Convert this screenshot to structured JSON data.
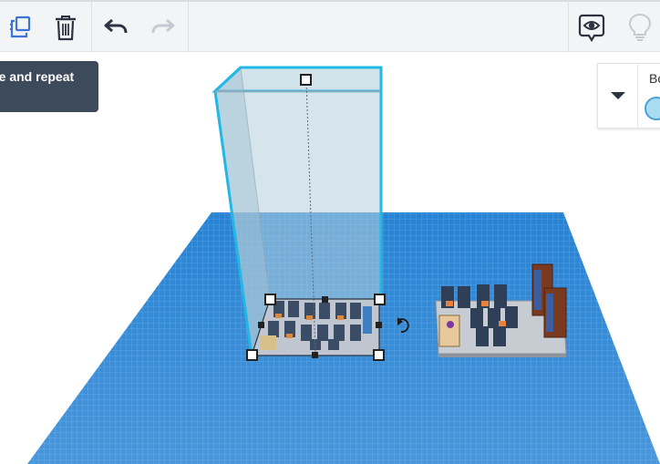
{
  "toolbar": {
    "items": [
      {
        "name": "duplicate-and-repeat",
        "icon": "duplicate-icon"
      },
      {
        "name": "delete",
        "icon": "trash-icon"
      },
      {
        "name": "undo",
        "icon": "undo-arrow-icon"
      },
      {
        "name": "redo",
        "icon": "redo-arrow-icon",
        "disabled": true
      },
      {
        "name": "show-all",
        "icon": "eye-speech-bubble-icon"
      },
      {
        "name": "notes",
        "icon": "lightbulb-icon",
        "disabled": true
      }
    ]
  },
  "tooltip": {
    "text": "te and repeat"
  },
  "inspector": {
    "label": "Bo",
    "color_swatch": "#a9dcf0",
    "collapse_icon": "caret-down-icon"
  },
  "colors": {
    "workplane": "#1a7bd1",
    "workplane_grid": "#5aa8e8",
    "selection": "#22b8e6",
    "toolbar_bg": "#f3f4f6",
    "icon_active": "#2d3340",
    "icon_disabled": "#c5cad2",
    "duplicate_icon": "#3a74d6"
  }
}
